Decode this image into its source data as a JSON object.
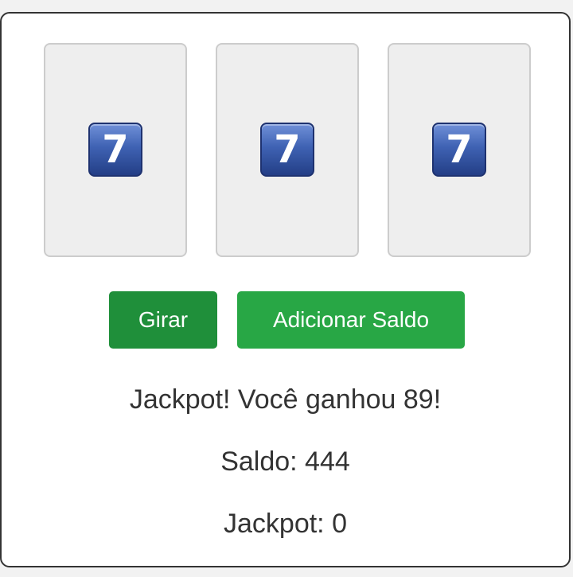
{
  "reels": [
    {
      "symbol": "7",
      "icon": "keycap-seven-icon"
    },
    {
      "symbol": "7",
      "icon": "keycap-seven-icon"
    },
    {
      "symbol": "7",
      "icon": "keycap-seven-icon"
    }
  ],
  "buttons": {
    "spin_label": "Girar",
    "add_balance_label": "Adicionar Saldo"
  },
  "status": {
    "message": "Jackpot! Você ganhou 89!",
    "balance": "Saldo: 444",
    "jackpot": "Jackpot: 0"
  },
  "colors": {
    "spin_button": "#1f8f3a",
    "add_button": "#28a745",
    "reel_bg": "#eeeeee",
    "text": "#333333"
  }
}
